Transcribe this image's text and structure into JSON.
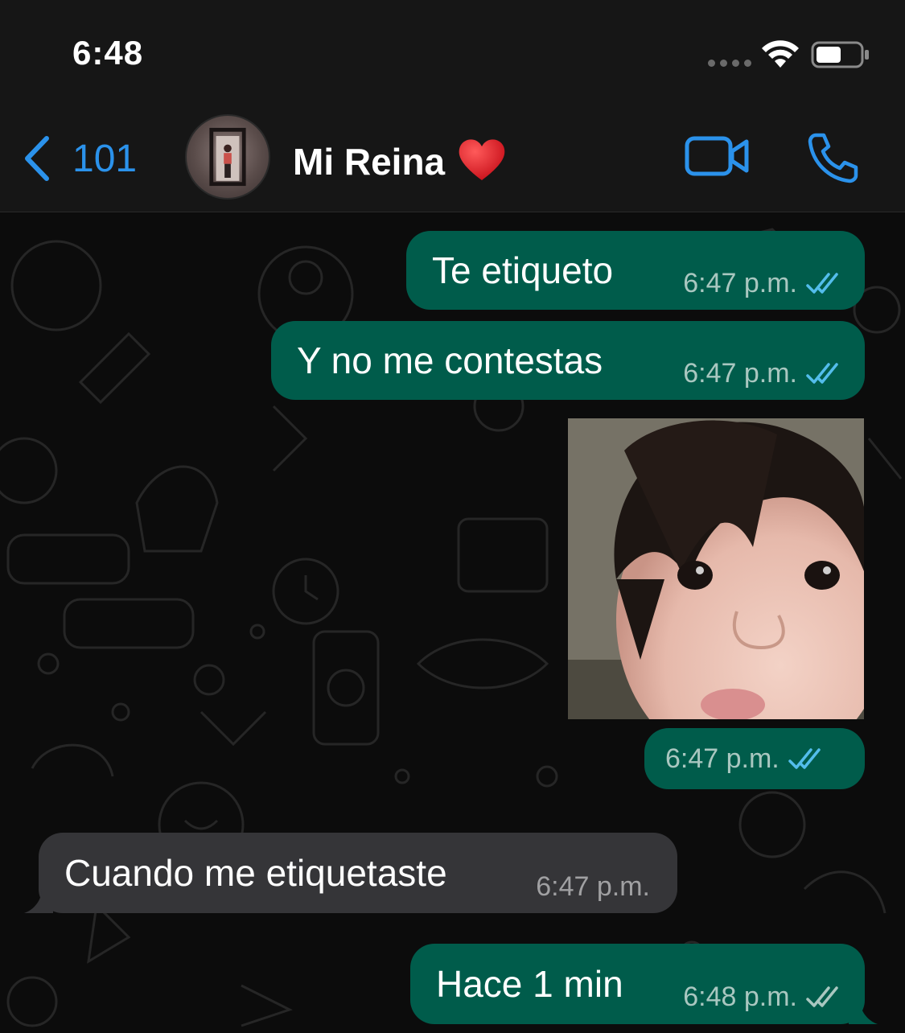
{
  "status_bar": {
    "time": "6:48"
  },
  "header": {
    "back_count": "101",
    "contact_name": "Mi Reina"
  },
  "messages": [
    {
      "direction": "outgoing",
      "text": "Te etiqueto",
      "time": "6:47 p.m.",
      "status": "read"
    },
    {
      "direction": "outgoing",
      "text": "Y no me contestas",
      "time": "6:47 p.m.",
      "status": "read"
    },
    {
      "direction": "outgoing",
      "type": "image",
      "time": "6:47 p.m.",
      "status": "read"
    },
    {
      "direction": "incoming",
      "text": "Cuando me etiquetaste",
      "time": "6:47 p.m."
    },
    {
      "direction": "outgoing",
      "text": "Hace 1 min",
      "time": "6:48 p.m.",
      "status": "delivered"
    }
  ],
  "colors": {
    "accent": "#2b92eb",
    "outgoing_bubble": "#005c4b",
    "incoming_bubble": "#353538",
    "read_ticks": "#53bdeb",
    "delivered_ticks": "#a9c7c0"
  },
  "icons": [
    "chevron-left-icon",
    "video-camera-icon",
    "phone-icon",
    "wifi-icon",
    "battery-icon",
    "heart-icon",
    "double-check-icon"
  ]
}
